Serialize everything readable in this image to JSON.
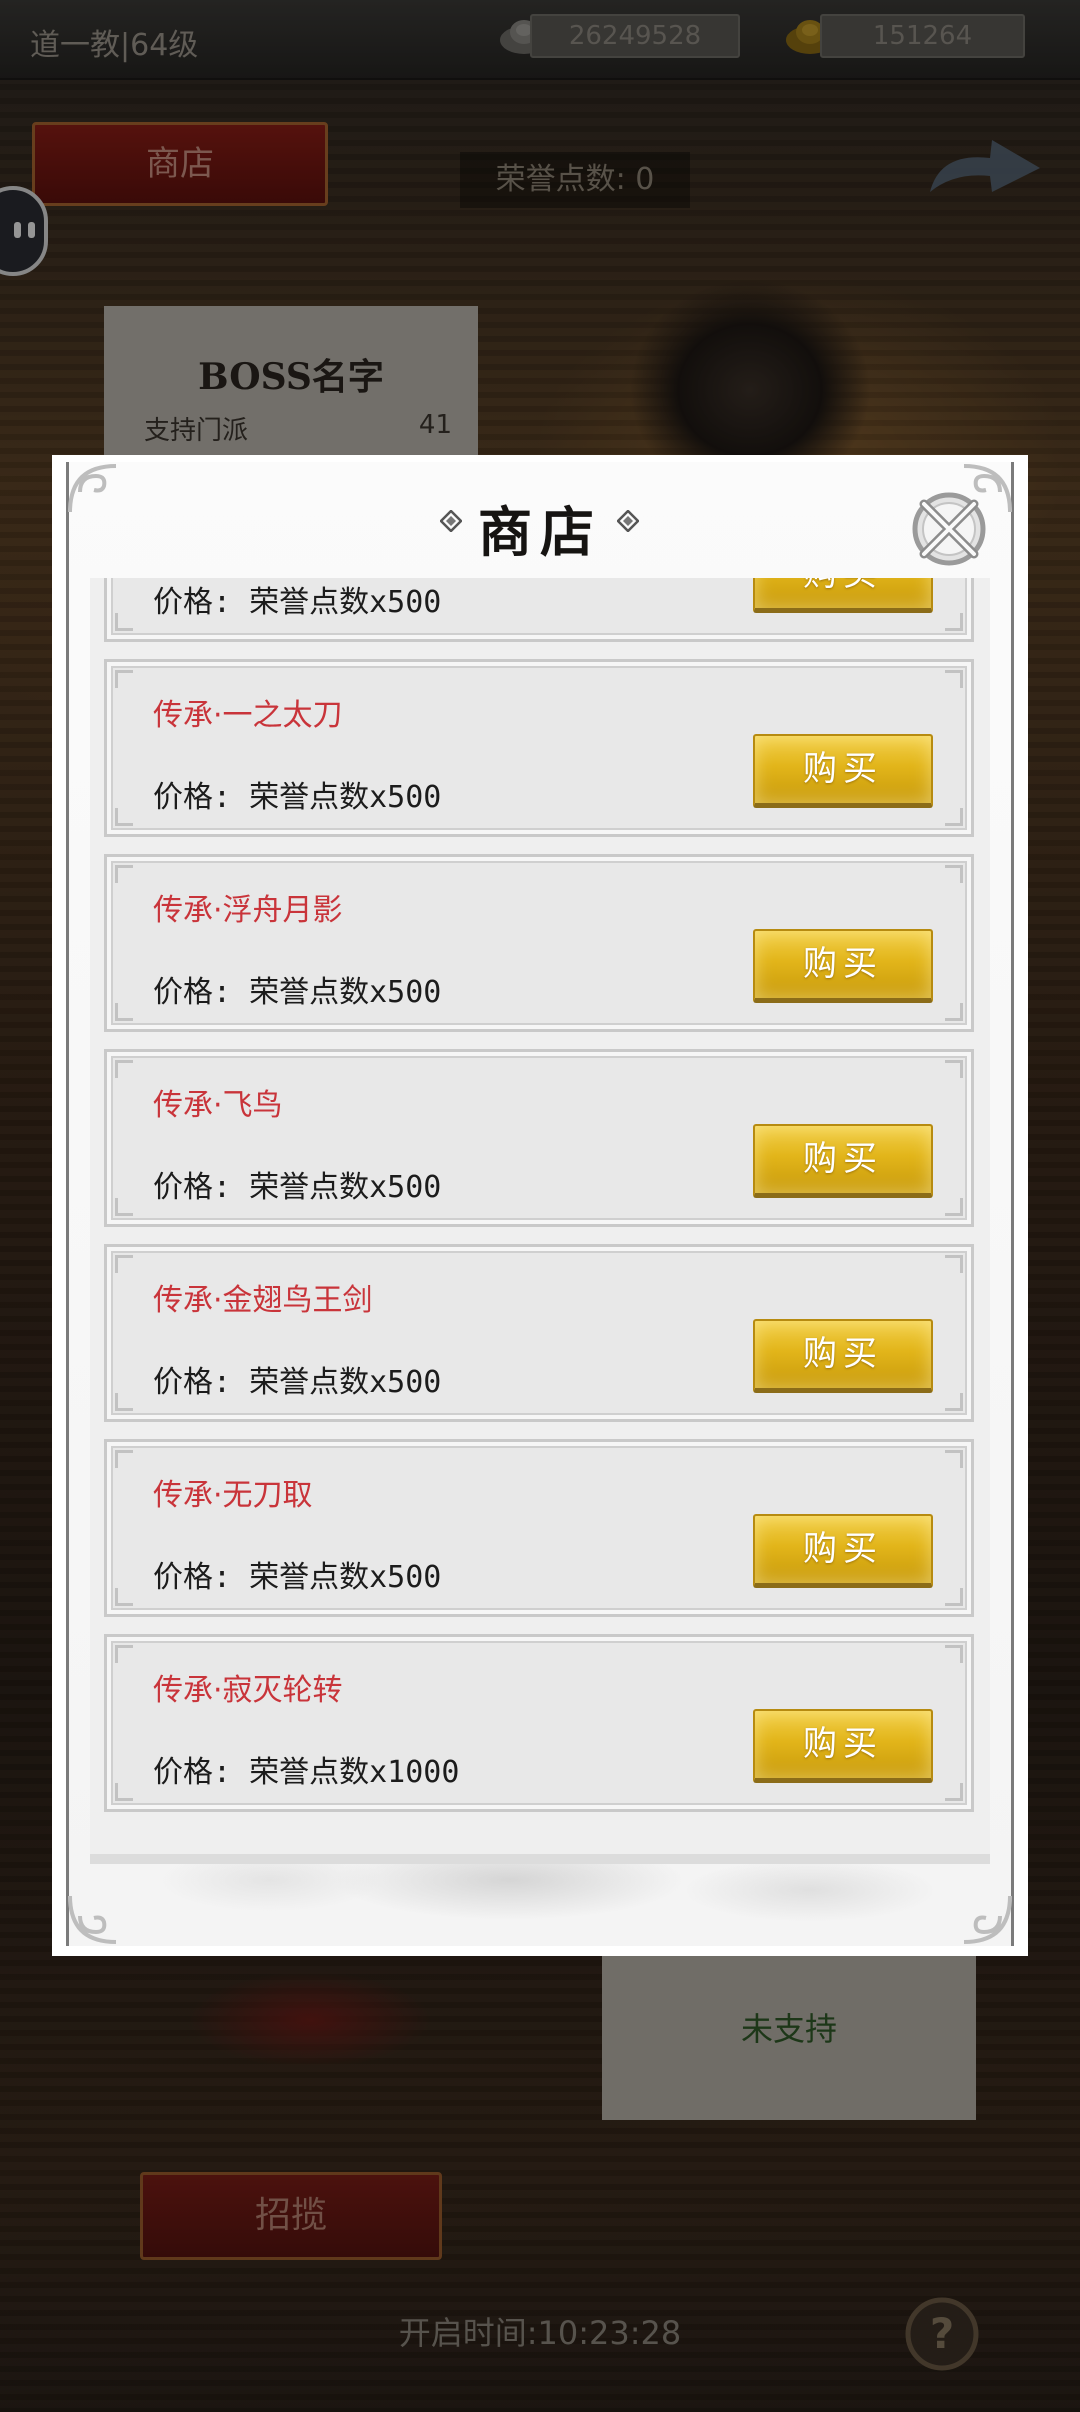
{
  "topbar": {
    "player_name": "道一教|64级",
    "silver_amount": "26249528",
    "gold_amount": "151264",
    "silver_icon": "silver-ingot-icon",
    "gold_icon": "gold-ingot-icon"
  },
  "background": {
    "shop_tab_label": "商店",
    "honor_points_label": "荣誉点数: 0",
    "boss_card": {
      "title": "BOSS名字",
      "row_label": "支持门派",
      "row_value": "41"
    },
    "unsupported_label": "未支持",
    "recruit_button_label": "招揽",
    "open_time_label": "开启时间:10:23:28"
  },
  "modal": {
    "title": "商店",
    "buy_label": "购买",
    "items": [
      {
        "name": "",
        "price": "价格: 荣誉点数x500"
      },
      {
        "name": "传承·一之太刀",
        "price": "价格: 荣誉点数x500"
      },
      {
        "name": "传承·浮舟月影",
        "price": "价格: 荣誉点数x500"
      },
      {
        "name": "传承·飞鸟",
        "price": "价格: 荣誉点数x500"
      },
      {
        "name": "传承·金翅鸟王剑",
        "price": "价格: 荣誉点数x500"
      },
      {
        "name": "传承·无刀取",
        "price": "价格: 荣誉点数x500"
      },
      {
        "name": "传承·寂灭轮转",
        "price": "价格: 荣誉点数x1000"
      }
    ]
  },
  "colors": {
    "item_name": "#c9343a",
    "buy_button_gold": "#e2b51a",
    "shop_tab_red": "#8a1d16"
  }
}
